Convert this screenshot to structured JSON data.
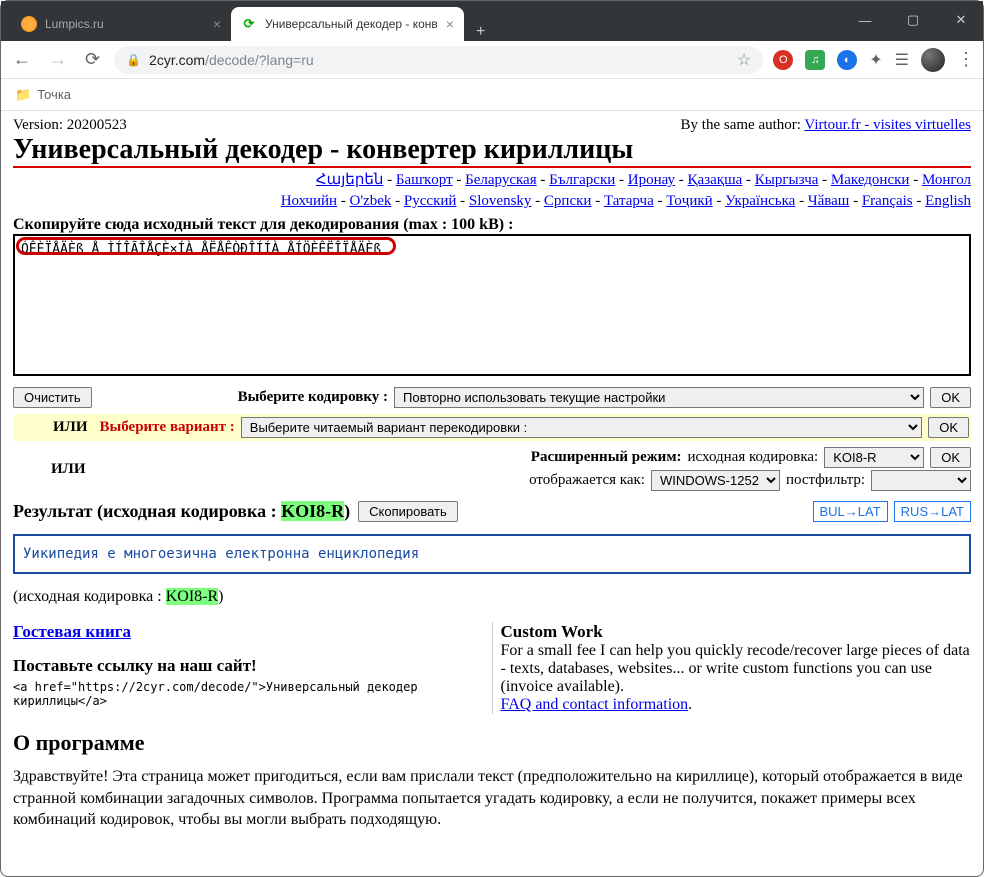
{
  "tabs": {
    "tab0": {
      "title": "Lumpics.ru"
    },
    "tab1": {
      "title": "Универсальный декодер - конв"
    }
  },
  "url": {
    "domain": "2cyr.com",
    "path": "/decode/?lang=ru"
  },
  "bookmarks": {
    "item0": "Точка"
  },
  "version": {
    "label": "Version: 20200523"
  },
  "sameauthor": {
    "prefix": "By the same author: ",
    "link": "Virtour.fr - visites virtuelles"
  },
  "h1": "Универсальный декодер - конвертер кириллицы",
  "langs": {
    "l0": "Հայերեն",
    "l1": "Башҡорт",
    "l2": "Беларуская",
    "l3": "Български",
    "l4": "Иронау",
    "l5": "Қазақша",
    "l6": "Кыргызча",
    "l7": "Македонски",
    "l8": "Монгол",
    "l9": "Нохчийн",
    "l10": "O'zbek",
    "l11": "Русский",
    "l12": "Slovensky",
    "l13": "Српски",
    "l14": "Татарча",
    "l15": "Тоҷикӣ",
    "l16": "Українська",
    "l17": "Чӑваш",
    "l18": "Français",
    "l19": "English"
  },
  "instr": "Скопируйте сюда исходный текст для декодирования (max : 100 kB) :",
  "input_text": "ÓÊÈÏÅÄÈß Å ÌÍÎÃÎÅÇÈ×ÍÀ ÅËÅÊÒÐÎÍÍÀ ÅÍÖÈÊËÎÏÅÄÈß",
  "btn": {
    "clear": "Очистить",
    "ok": "OK",
    "copy": "Скопировать"
  },
  "row1": {
    "label": "Выберите кодировку :",
    "select": "Повторно использовать текущие настройки"
  },
  "row2": {
    "ili": "ИЛИ",
    "label": "Выберите вариант :",
    "select": "Выберите читаемый вариант перекодировки :"
  },
  "row3": {
    "ili": "ИЛИ",
    "label": "Расширенный режим:",
    "src_label": "исходная кодировка:",
    "src_val": "KOI8-R",
    "disp_label": "отображается как:",
    "disp_val": "WINDOWS-1252",
    "post_label": "постфильтр:",
    "post_val": ""
  },
  "result": {
    "prefix": "Результат (исходная кодировка : ",
    "enc": "KOI8-R",
    "suffix": ")",
    "bullat": "BUL→LAT",
    "ruslat": "RUS→LAT"
  },
  "result_text": "Уикипедия е многоезична електронна енциклопедия",
  "src_enc": {
    "prefix": "(исходная кодировка : ",
    "enc": "KOI8-R",
    "suffix": ")"
  },
  "left_col": {
    "guest": "Гостевая книга",
    "link_h": "Поставьте ссылку на наш сайт!",
    "code": "<a href=\"https://2cyr.com/decode/\">Универсальный декодер кириллицы</a>"
  },
  "right_col": {
    "h": "Custom Work",
    "text": "For a small fee I can help you quickly recode/recover large pieces of data - texts, databases, websites... or write custom functions you can use (invoice available).",
    "link": "FAQ and contact information"
  },
  "about": {
    "h": "О программе",
    "text": "Здравствуйте! Эта страница может пригодиться, если вам прислали текст (предположительно на кириллице), который отображается в виде странной комбинации загадочных символов. Программа попытается угадать кодировку, а если не получится, покажет примеры всех комбинаций кодировок, чтобы вы могли выбрать подходящую."
  }
}
